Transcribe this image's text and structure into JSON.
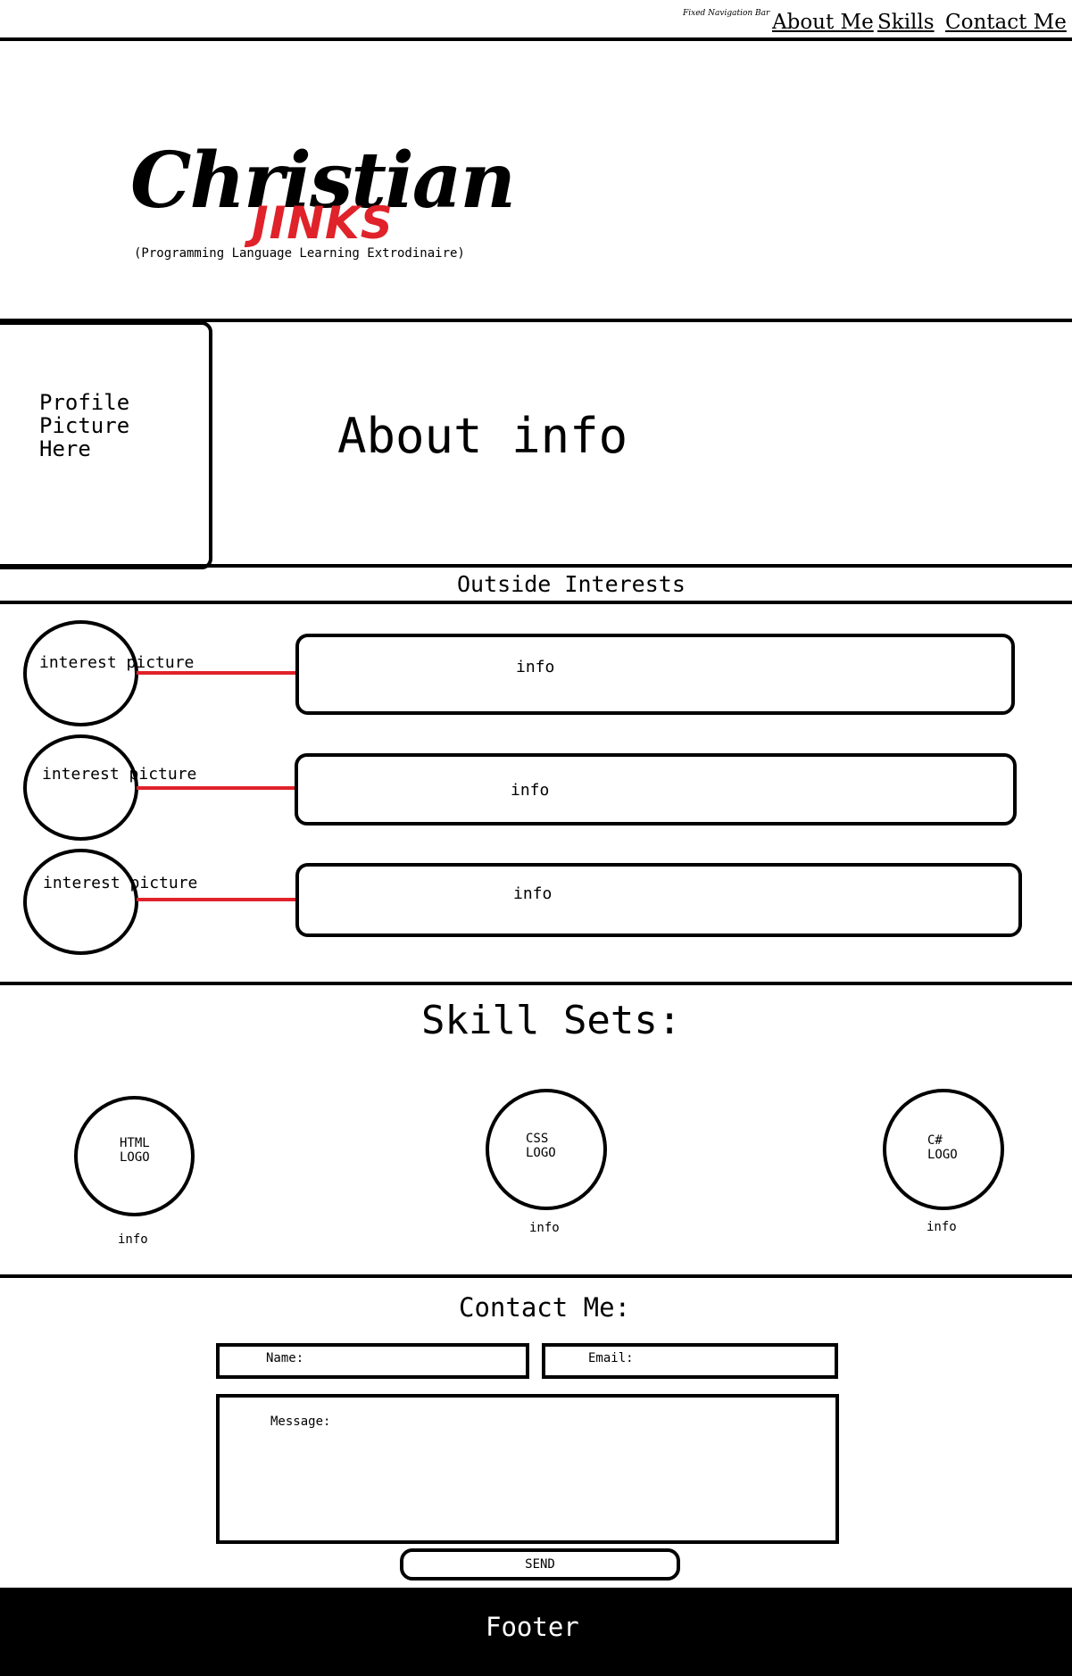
{
  "nav": {
    "note": "Fixed Navigation Bar",
    "links": [
      "About Me",
      "Skills",
      "Contact Me"
    ]
  },
  "header": {
    "logo_main": "Christian",
    "logo_sub": "JINKS",
    "tagline": "(Programming Language Learning Extrodinaire)"
  },
  "about": {
    "profile_placeholder": "Profile Picture Here",
    "info": "About info"
  },
  "interests": {
    "title": "Outside Interests",
    "items": [
      {
        "picture": "interest picture",
        "info": "info"
      },
      {
        "picture": "interest picture",
        "info": "info"
      },
      {
        "picture": "interest picture",
        "info": "info"
      }
    ]
  },
  "skills": {
    "title": "Skill Sets:",
    "items": [
      {
        "logo": "HTML LOGO",
        "info": "info"
      },
      {
        "logo": "CSS LOGO",
        "info": "info"
      },
      {
        "logo": "C# LOGO",
        "info": "info"
      }
    ]
  },
  "contact": {
    "title": "Contact Me:",
    "name_label": "Name:",
    "email_label": "Email:",
    "message_label": "Message:",
    "send_label": "SEND"
  },
  "footer": {
    "text": "Footer"
  },
  "colors": {
    "accent": "#e0222a",
    "ink": "#000000",
    "background": "#ffffff"
  }
}
